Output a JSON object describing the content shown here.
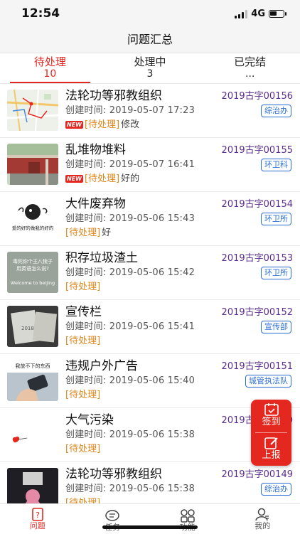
{
  "status_bar": {
    "time": "12:54",
    "network": "4G",
    "battery_level": 0.55
  },
  "nav": {
    "title": "问题汇总"
  },
  "tabs": [
    {
      "label": "待处理",
      "count": "10"
    },
    {
      "label": "处理中",
      "count": "3"
    },
    {
      "label": "已完结",
      "count": "..."
    }
  ],
  "created_label": "创建时间:",
  "items": [
    {
      "title": "法轮功等邪教组织",
      "code": "2019古字00156",
      "time": "2019-05-07 17:23",
      "dept": "综治办",
      "status": "[待处理]",
      "note": "修改",
      "new": "NEW",
      "thumb": "map"
    },
    {
      "title": "乱堆物堆料",
      "code": "2019古字00155",
      "time": "2019-05-07 16:41",
      "dept": "环卫科",
      "status": "[待处理]",
      "note": "好的",
      "new": "NEW",
      "thumb": "wall"
    },
    {
      "title": "大件废弃物",
      "code": "2019古字00154",
      "time": "2019-05-06 15:43",
      "dept": "环卫所",
      "status": "[待处理]",
      "note": "好",
      "new": "",
      "thumb": "calligraphy"
    },
    {
      "title": "积存垃圾渣土",
      "code": "2019古字00153",
      "time": "2019-05-06 15:42",
      "dept": "环卫所",
      "status": "[待处理]",
      "note": "",
      "new": "",
      "thumb": "quote"
    },
    {
      "title": "宣传栏",
      "code": "2019古字00152",
      "time": "2019-05-06 15:41",
      "dept": "宣传部",
      "status": "[待处理]",
      "note": "",
      "new": "",
      "thumb": "notebook"
    },
    {
      "title": "违规户外广告",
      "code": "2019古字00151",
      "time": "2019-05-06 15:40",
      "dept": "城管执法队",
      "status": "[待处理]",
      "note": "",
      "new": "",
      "thumb": "phone"
    },
    {
      "title": "大气污染",
      "code": "2019古字00150",
      "time": "2019-05-06 15:38",
      "dept": "",
      "status": "[待处理]",
      "note": "",
      "new": "",
      "thumb": "heart"
    },
    {
      "title": "法轮功等邪教组织",
      "code": "2019古字00149",
      "time": "2019-05-06 15:38",
      "dept": "综治办",
      "status": "[待处理]",
      "note": "",
      "new": "",
      "thumb": "dark"
    }
  ],
  "thumb_texts": {
    "calligraphy": "爱的好的做我的好的",
    "quote": "毒死你个王八犊子用英语怎么说?",
    "quote_en": "Welcome to beijing",
    "notebook": "2018",
    "phone": "我放不下的东西"
  },
  "float_buttons": {
    "signin": "签到",
    "report": "上报"
  },
  "bottom_nav": [
    {
      "label": "问题",
      "icon": "question-doc-icon"
    },
    {
      "label": "任务",
      "icon": "task-chat-icon"
    },
    {
      "label": "功能",
      "icon": "grid-icon"
    },
    {
      "label": "我的",
      "icon": "person-icon"
    }
  ],
  "colors": {
    "accent": "#e5281f",
    "code": "#5b2d8e",
    "dept": "#2b6fd6",
    "status": "#e0861a"
  }
}
